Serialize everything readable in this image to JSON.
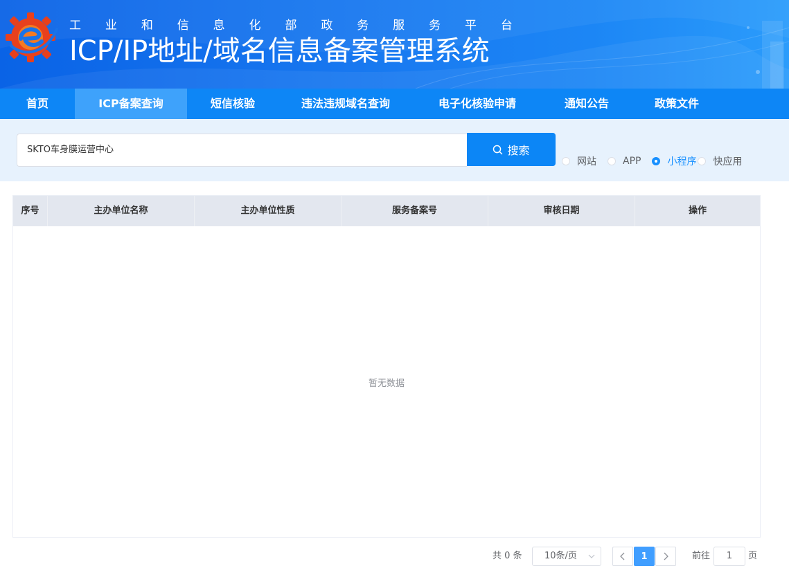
{
  "header": {
    "subtitle_chars": [
      "工",
      "业",
      "和",
      "信",
      "息",
      "化",
      "部",
      "政",
      "务",
      "服",
      "务",
      "平",
      "台"
    ],
    "title": "ICP/IP地址/域名信息备案管理系统"
  },
  "nav": {
    "items": [
      {
        "label": "首页",
        "active": false
      },
      {
        "label": "ICP备案查询",
        "active": true
      },
      {
        "label": "短信核验",
        "active": false
      },
      {
        "label": "违法违规域名查询",
        "active": false
      },
      {
        "label": "电子化核验申请",
        "active": false
      },
      {
        "label": "通知公告",
        "active": false
      },
      {
        "label": "政策文件",
        "active": false
      }
    ]
  },
  "search": {
    "value": "SKTO车身膜运营中心",
    "button_label": "搜索",
    "button_icon": "search-icon",
    "types": [
      {
        "label": "网站",
        "checked": false
      },
      {
        "label": "APP",
        "checked": false
      },
      {
        "label": "小程序",
        "checked": true
      },
      {
        "label": "快应用",
        "checked": false
      }
    ]
  },
  "table": {
    "columns": [
      "序号",
      "主办单位名称",
      "主办单位性质",
      "服务备案号",
      "审核日期",
      "操作"
    ],
    "rows": [],
    "empty_text": "暂无数据"
  },
  "pagination": {
    "total_text": "共 0 条",
    "page_size": "10条/页",
    "current_page": "1",
    "goto_label": "前往",
    "goto_value": "1",
    "page_unit": "页"
  },
  "colors": {
    "primary": "#0c86f6",
    "nav_active": "#3ea2fb",
    "search_band": "#e7f2fd",
    "table_header": "#e3e7ef",
    "radio_checked": "#1890ff"
  }
}
